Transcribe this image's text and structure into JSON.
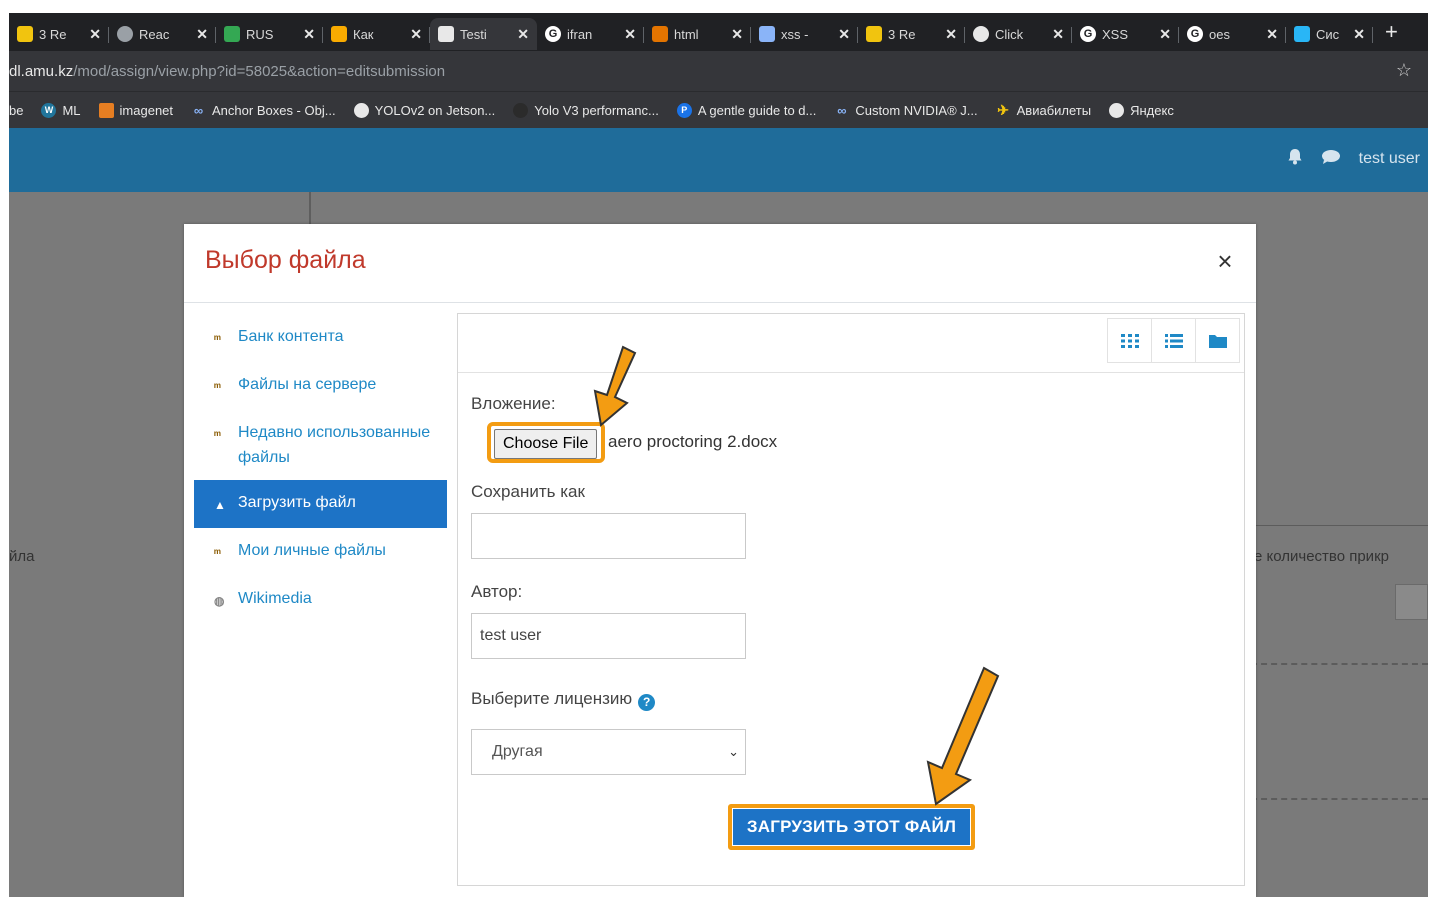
{
  "browser": {
    "tabs": [
      {
        "title": "3 Re",
        "icon_color": "#f1c40f",
        "active": false
      },
      {
        "title": "Reac",
        "icon_color": "#9aa0a6",
        "active": false
      },
      {
        "title": "RUS",
        "icon_color": "#34a853",
        "active": false
      },
      {
        "title": "Как",
        "icon_color": "#f9ab00",
        "active": false
      },
      {
        "title": "Testi",
        "icon_color": "#e8e8e8",
        "active": true
      },
      {
        "title": "ifran",
        "icon_color": "#ffffff",
        "active": false
      },
      {
        "title": "html",
        "icon_color": "#e37400",
        "active": false
      },
      {
        "title": "xss -",
        "icon_color": "#8ab4f8",
        "active": false
      },
      {
        "title": "3 Re",
        "icon_color": "#f1c40f",
        "active": false
      },
      {
        "title": "Click",
        "icon_color": "#e8e8e8",
        "active": false
      },
      {
        "title": "XSS",
        "icon_color": "#ffffff",
        "active": false
      },
      {
        "title": "oes",
        "icon_color": "#ffffff",
        "active": false
      },
      {
        "title": "Сис",
        "icon_color": "#29b6f6",
        "active": false
      }
    ],
    "new_tab": "+",
    "url_host": "dl.amu.kz",
    "url_path": "/mod/assign/view.php?id=58025&action=editsubmission",
    "bookmarks": [
      {
        "label": "be",
        "icon_color": "#35363a"
      },
      {
        "label": "ML",
        "icon_color": "#21759b"
      },
      {
        "label": "imagenet",
        "icon_color": "#e67e22"
      },
      {
        "label": "Anchor Boxes - Obj...",
        "icon_color": "#8ab4f8"
      },
      {
        "label": "YOLOv2 on Jetson...",
        "icon_color": "#e8e8e8"
      },
      {
        "label": "Yolo V3 performanc...",
        "icon_color": "#2b2b2b"
      },
      {
        "label": "A gentle guide to d...",
        "icon_color": "#1a73e8"
      },
      {
        "label": "Custom NVIDIA® J...",
        "icon_color": "#8ab4f8"
      },
      {
        "label": "Авиабилеты",
        "icon_color": "#f1c40f"
      },
      {
        "label": "Яндекс",
        "icon_color": "#e8e8e8"
      }
    ]
  },
  "navbar": {
    "user": "test user"
  },
  "background": {
    "left_text": "йла",
    "right_text": "е количество прикр"
  },
  "dialog": {
    "title": "Выбор файла",
    "close": "×",
    "sidebar": [
      {
        "label": "Банк контента",
        "icon": "m",
        "active": false
      },
      {
        "label": "Файлы на сервере",
        "icon": "m",
        "active": false
      },
      {
        "label": "Недавно использованные файлы",
        "icon": "m",
        "active": false
      },
      {
        "label": "Загрузить файл",
        "icon": "upload",
        "active": true
      },
      {
        "label": "Мои личные файлы",
        "icon": "m",
        "active": false
      },
      {
        "label": "Wikimedia",
        "icon": "globe",
        "active": false
      }
    ],
    "form": {
      "attachment_label": "Вложение:",
      "choose_file": "Choose File",
      "file_name": "aero proctoring 2.docx",
      "save_as_label": "Сохранить как",
      "save_as_value": "",
      "author_label": "Автор:",
      "author_value": "test user",
      "license_label": "Выберите лицензию",
      "license_value": "Другая",
      "upload_button": "ЗАГРУЗИТЬ ЭТОТ ФАЙЛ"
    }
  },
  "colors": {
    "highlight": "#f39c12",
    "moodle_blue": "#1d73c6",
    "navbar": "#1f6c9a",
    "title_red": "#c0392b"
  }
}
